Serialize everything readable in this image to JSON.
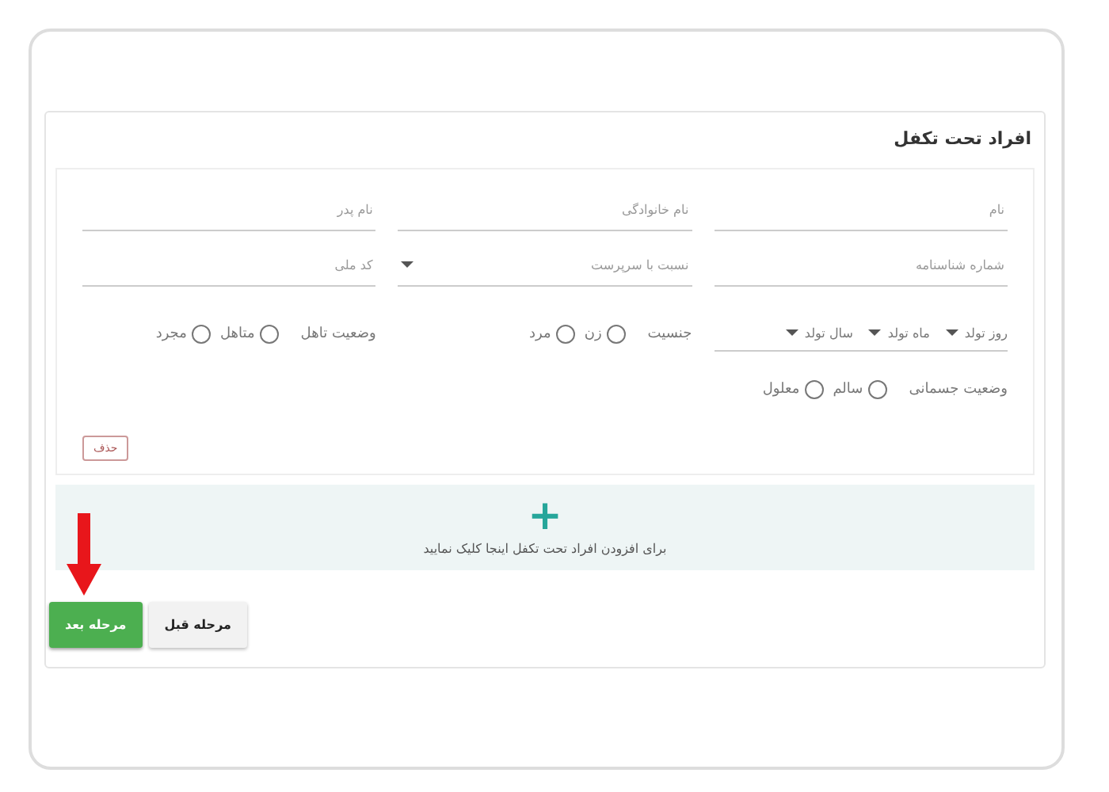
{
  "section": {
    "title": "افراد تحت تکفل"
  },
  "fields": [
    {
      "kind": "text",
      "placeholder": "نام"
    },
    {
      "kind": "text",
      "placeholder": "نام خانوادگی"
    },
    {
      "kind": "text",
      "placeholder": "نام پدر"
    },
    {
      "kind": "text",
      "placeholder": "شماره شناسنامه"
    },
    {
      "kind": "select",
      "placeholder": "نسبت با سرپرست"
    },
    {
      "kind": "text",
      "placeholder": "کد ملی"
    }
  ],
  "birth_date": [
    "روز تولد",
    "ماه تولد",
    "سال تولد"
  ],
  "radio_groups": [
    {
      "label": "جنسیت",
      "options": [
        {
          "label": "زن",
          "selected": false
        },
        {
          "label": "مرد",
          "selected": false
        }
      ]
    },
    {
      "label": "وضعیت تاهل",
      "options": [
        {
          "label": "متاهل",
          "selected": false
        },
        {
          "label": "مجرد",
          "selected": false
        }
      ]
    },
    {
      "label": "وضعیت جسمانی",
      "options": [
        {
          "label": "سالم",
          "selected": false
        },
        {
          "label": "معلول",
          "selected": false
        }
      ]
    }
  ],
  "delete_button": "حذف",
  "add_area": {
    "icon": "+",
    "text": "برای افزودن افراد تحت تکفل اینجا کلیک نمایید"
  },
  "buttons": [
    {
      "kind": "secondary",
      "label": "مرحله قبل"
    },
    {
      "kind": "primary",
      "label": "مرحله بعد"
    }
  ]
}
